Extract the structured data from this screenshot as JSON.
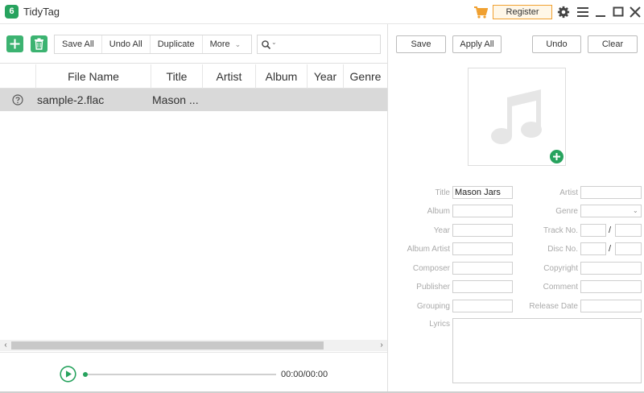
{
  "app": {
    "title": "TidyTag",
    "logo_letter": "6"
  },
  "titlebar": {
    "register_label": "Register"
  },
  "toolbar": {
    "save_all": "Save All",
    "undo_all": "Undo All",
    "duplicate": "Duplicate",
    "more": "More",
    "search_value": ""
  },
  "table": {
    "columns": [
      "File Name",
      "Title",
      "Artist",
      "Album",
      "Year",
      "Genre"
    ],
    "rows": [
      {
        "file_name": "sample-2.flac",
        "title": "Mason ..."
      }
    ]
  },
  "player": {
    "time": "00:00/00:00",
    "progress": 0
  },
  "right_panel": {
    "save": "Save",
    "apply_all": "Apply All",
    "undo": "Undo",
    "clear": "Clear"
  },
  "fields": {
    "title_label": "Title",
    "title_value": "Mason Jars",
    "artist_label": "Artist",
    "artist_value": "",
    "album_label": "Album",
    "album_value": "",
    "genre_label": "Genre",
    "genre_value": "",
    "year_label": "Year",
    "year_value": "",
    "track_label": "Track No.",
    "track_value": "",
    "track_total": "",
    "album_artist_label": "Album Artist",
    "album_artist_value": "",
    "disc_label": "Disc No.",
    "disc_value": "",
    "disc_total": "",
    "composer_label": "Composer",
    "composer_value": "",
    "copyright_label": "Copyright",
    "copyright_value": "",
    "publisher_label": "Publisher",
    "publisher_value": "",
    "comment_label": "Comment",
    "comment_value": "",
    "grouping_label": "Grouping",
    "grouping_value": "",
    "release_date_label": "Release Date",
    "release_date_value": "",
    "lyrics_label": "Lyrics",
    "lyrics_value": "",
    "slash": "/"
  },
  "colors": {
    "accent": "#27a35e",
    "register_border": "#f0a030",
    "selected_row": "#d9d9d9"
  }
}
